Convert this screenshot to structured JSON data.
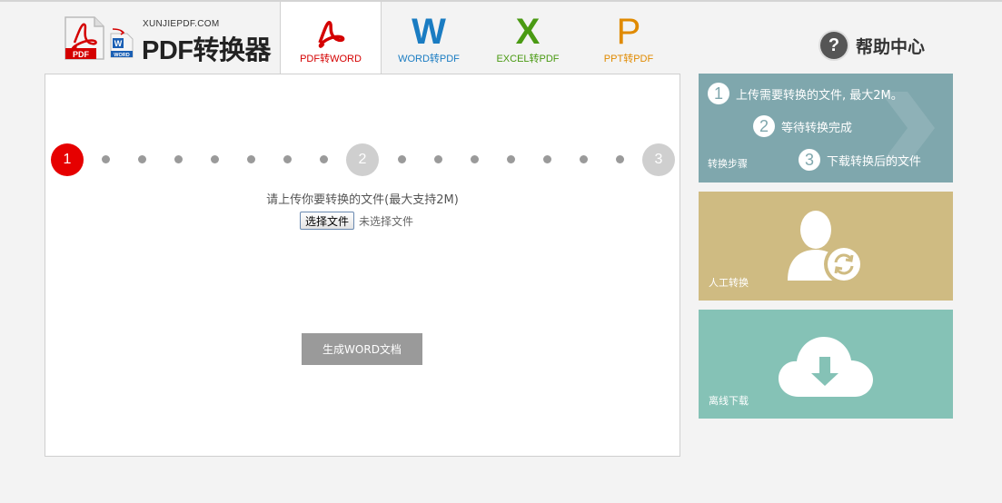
{
  "logo": {
    "pdf_tag": "PDF",
    "word_tag": "WORD",
    "small_text": "XUNJIEPDF.COM",
    "big_text": "PDF转换器"
  },
  "tabs": [
    {
      "letter": "",
      "label": "PDF转WORD",
      "color": "#d40000",
      "active": true,
      "icon": "pdf-acrobat-icon"
    },
    {
      "letter": "W",
      "label": "WORD转PDF",
      "color": "#1a7cc2",
      "active": false,
      "icon": "word-icon"
    },
    {
      "letter": "X",
      "label": "EXCEL转PDF",
      "color": "#4a9a13",
      "active": false,
      "icon": "excel-icon"
    },
    {
      "letter": "P",
      "label": "PPT转PDF",
      "color": "#e08a00",
      "active": false,
      "icon": "ppt-icon"
    }
  ],
  "help": {
    "icon_text": "?",
    "label": "帮助中心"
  },
  "progress": {
    "steps": [
      "1",
      "2",
      "3"
    ],
    "current_step": 1
  },
  "upload": {
    "hint": "请上传你要转换的文件(最大支持2M)",
    "button_label": "选择文件",
    "status": "未选择文件"
  },
  "generate_button": "生成WORD文档",
  "cards": {
    "steps": {
      "label": "转换步骤",
      "lines": [
        {
          "num": "1",
          "text": "上传需要转换的文件, 最大2M。"
        },
        {
          "num": "2",
          "text": "等待转换完成"
        },
        {
          "num": "3",
          "text": "下载转换后的文件"
        }
      ]
    },
    "manual": {
      "label": "人工转换"
    },
    "download": {
      "label": "离线下载"
    }
  },
  "colors": {
    "accent_red": "#e60000",
    "steps_card": "#7fa7ad",
    "manual_card": "#cfbb82",
    "download_card": "#85c2b6"
  }
}
